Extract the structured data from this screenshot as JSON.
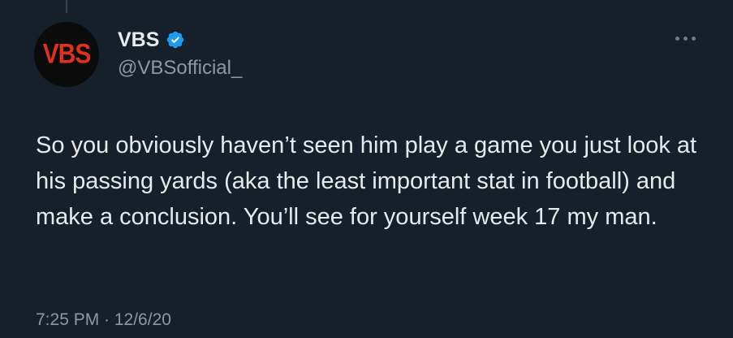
{
  "author": {
    "avatar_text": "VBS",
    "display_name": "VBS",
    "handle": "@VBSofficial_",
    "verified": true
  },
  "icons": {
    "verified": "verified-badge-icon",
    "more": "more-options-icon"
  },
  "colors": {
    "background": "#15202b",
    "verified": "#1d9bf0",
    "avatar_text": "#e0301e",
    "secondary_text": "#8b98a5"
  },
  "tweet": {
    "text": "So you obviously haven’t seen him play a game you just look at his passing yards (aka the least important stat in football) and make a conclusion. You’ll see for yourself week 17 my man.",
    "timestamp": "7:25 PM · 12/6/20"
  }
}
